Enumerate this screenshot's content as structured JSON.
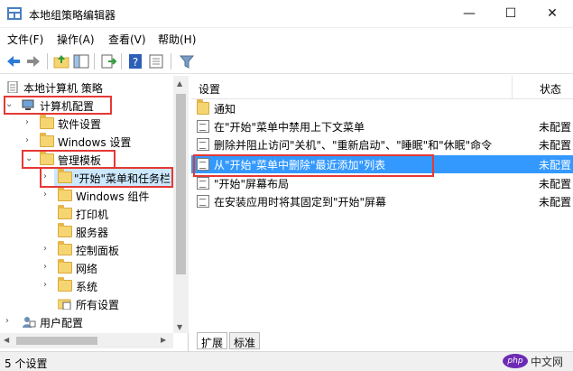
{
  "window": {
    "title": "本地组策略编辑器",
    "minimize": "—",
    "maximize": "☐",
    "close": "✕"
  },
  "menu": [
    "文件(F)",
    "操作(A)",
    "查看(V)",
    "帮助(H)"
  ],
  "toolbar": {
    "buttons": [
      "back-icon",
      "forward-icon",
      "up-folder-icon",
      "show-hide-tree-icon",
      "export-list-icon",
      "help-icon",
      "properties-icon",
      "filter-icon"
    ]
  },
  "tree": {
    "root": "本地计算机 策略",
    "computer_config": "计算机配置",
    "software_settings": "软件设置",
    "windows_settings": "Windows 设置",
    "admin_templates": "管理模板",
    "start_menu_taskbar": "\"开始\"菜单和任务栏",
    "windows_components": "Windows 组件",
    "printers": "打印机",
    "servers": "服务器",
    "control_panel": "控制面板",
    "network": "网络",
    "system": "系统",
    "all_settings": "所有设置",
    "user_config": "用户配置"
  },
  "list": {
    "col_setting": "设置",
    "col_state": "状态",
    "rows": [
      {
        "label": "通知",
        "state": "",
        "type": "folder"
      },
      {
        "label": "在\"开始\"菜单中禁用上下文菜单",
        "state": "未配置",
        "type": "policy"
      },
      {
        "label": "删除并阻止访问\"关机\"、\"重新启动\"、\"睡眠\"和\"休眠\"命令",
        "state": "未配置",
        "type": "policy"
      },
      {
        "label": "从\"开始\"菜单中删除\"最近添加\"列表",
        "state": "未配置",
        "type": "policy"
      },
      {
        "label": "\"开始\"屏幕布局",
        "state": "未配置",
        "type": "policy"
      },
      {
        "label": "在安装应用时将其固定到\"开始\"屏幕",
        "state": "未配置",
        "type": "policy"
      }
    ]
  },
  "tabs": {
    "extended": "扩展",
    "standard": "标准"
  },
  "status": {
    "text": "5 个设置"
  },
  "watermark": {
    "logo": "php",
    "text": "中文网"
  },
  "colors": {
    "highlight": "#3399ff",
    "annotation": "#e53935",
    "selection": "#cce8ff"
  }
}
